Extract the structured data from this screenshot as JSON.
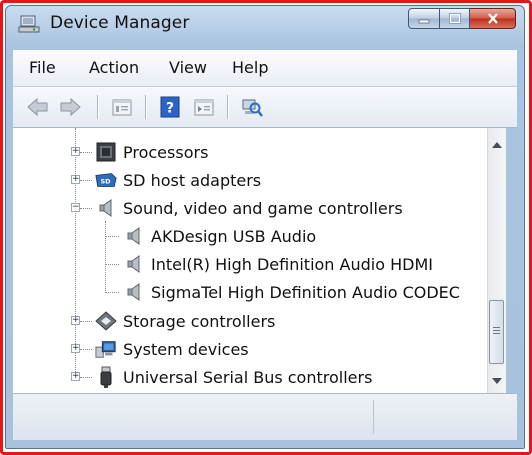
{
  "window": {
    "title": "Device Manager"
  },
  "menubar": {
    "items": [
      "File",
      "Action",
      "View",
      "Help"
    ]
  },
  "toolbar": {
    "buttons": [
      "back-arrow-icon",
      "forward-arrow-icon",
      "properties-icon",
      "help-icon",
      "details-icon",
      "scan-hardware-icon"
    ]
  },
  "tree": {
    "items": [
      {
        "label": "Processors",
        "icon": "processor-icon",
        "level": 1,
        "expanded": false
      },
      {
        "label": "SD host adapters",
        "icon": "sd-card-icon",
        "level": 1,
        "expanded": false
      },
      {
        "label": "Sound, video and game controllers",
        "icon": "speaker-icon",
        "level": 1,
        "expanded": true
      },
      {
        "label": "AKDesign USB Audio",
        "icon": "speaker-icon",
        "level": 2
      },
      {
        "label": "Intel(R) High Definition Audio HDMI",
        "icon": "speaker-icon",
        "level": 2
      },
      {
        "label": "SigmaTel High Definition Audio CODEC",
        "icon": "speaker-icon",
        "level": 2
      },
      {
        "label": "Storage controllers",
        "icon": "storage-icon",
        "level": 1,
        "expanded": false
      },
      {
        "label": "System devices",
        "icon": "computer-icon",
        "level": 1,
        "expanded": false
      },
      {
        "label": "Universal Serial Bus controllers",
        "icon": "usb-icon",
        "level": 1,
        "expanded": false
      }
    ]
  },
  "colors": {
    "frame": "#e01818",
    "title_bar": "#b3cbe4",
    "close_button": "#c0301c"
  }
}
